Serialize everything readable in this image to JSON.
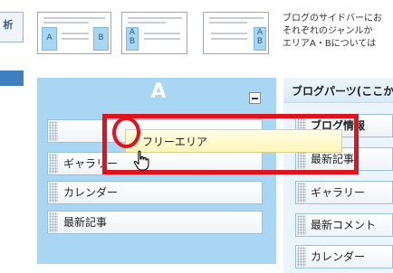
{
  "nav": {
    "tab_label": "析"
  },
  "thumbnails": [
    {
      "left_col": "A",
      "right_col": "B"
    },
    {
      "left_col": "A",
      "left_col2": "B"
    },
    {
      "right_col": "A",
      "right_col2": "B"
    }
  ],
  "description": {
    "line1": "ブログのサイドバーにお",
    "line2": "それぞれのジャンルか",
    "line3": "エリアA・Bについては"
  },
  "area_a": {
    "title": "A",
    "items": [
      "",
      "ギャラリー",
      "カレンダー",
      "最新記事"
    ]
  },
  "dragging_item": {
    "label": "フリーエリア"
  },
  "parts_panel": {
    "title": "ブログパーツ(ここか",
    "items": [
      "ブログ情報",
      "最新記事",
      "ギャラリー",
      "最新コメント",
      "カレンダー"
    ]
  },
  "colors": {
    "panel_bg": "#a9d6f3",
    "highlight_red": "#e0121b",
    "drag_bg": "#fff6b8"
  }
}
